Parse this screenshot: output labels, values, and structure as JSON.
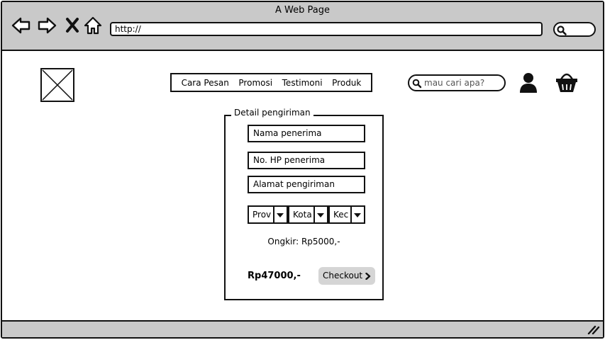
{
  "browser": {
    "window_title": "A Web Page",
    "url": "http://",
    "nav_icons": [
      "back-arrow-icon",
      "forward-arrow-icon",
      "close-x-icon",
      "home-icon"
    ]
  },
  "header": {
    "nav_items": [
      "Cara Pesan",
      "Promosi",
      "Testimoni",
      "Produk"
    ],
    "search_placeholder": "mau cari apa?"
  },
  "shipping_form": {
    "legend": "Detail pengiriman",
    "recipient_name": "Nama penerima",
    "recipient_phone": "No. HP penerima",
    "shipping_address": "Alamat pengiriman",
    "province": "Prov",
    "city": "Kota",
    "district": "Kec",
    "shipping_cost": "Ongkir: Rp5000,-",
    "total": "Rp47000,-",
    "checkout_label": "Checkout"
  },
  "colors": {
    "chrome_gray": "#c9c9c9",
    "button_gray": "#d5d5d5",
    "outline": "#111111"
  }
}
